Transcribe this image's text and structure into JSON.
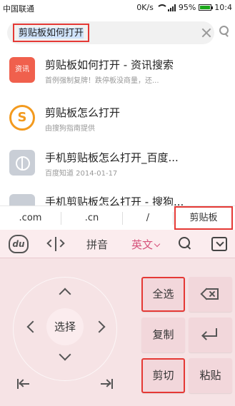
{
  "status_bar": {
    "carrier": "中国联通",
    "net_speed": "0K/s",
    "battery_percent": "95%",
    "time": "10:4"
  },
  "search": {
    "query": "剪贴板如何打开",
    "clear_icon": "clear-icon",
    "search_icon": "search-icon"
  },
  "results": [
    {
      "icon": "资讯",
      "title": "剪贴板如何打开 - 资讯搜索",
      "subtitle": "首例强制复牌！跌停板没商量，还..."
    },
    {
      "icon": "S",
      "title": "剪贴板怎么打开",
      "subtitle": "由搜狗指南提供"
    },
    {
      "icon": "globe-icon",
      "title": "手机剪贴板怎么打开_百度...",
      "subtitle": "百度知道   2014-01-17"
    },
    {
      "icon": "app-icon",
      "title": "手机剪贴板怎么打开 - 搜狗..."
    }
  ],
  "quickbar": {
    "items": [
      ".com",
      ".cn",
      "/",
      "剪贴板"
    ]
  },
  "keyboard": {
    "top": {
      "logo": "du",
      "pinyin": "拼音",
      "english": "英文"
    },
    "nav": {
      "select": "选择"
    },
    "keys": {
      "select_all": "全选",
      "copy": "复制",
      "cut": "剪切",
      "paste": "粘贴"
    }
  },
  "colors": {
    "highlight_box": "#e53935",
    "keyboard_bg": "#f6e3e5",
    "accent": "#d6527b"
  }
}
